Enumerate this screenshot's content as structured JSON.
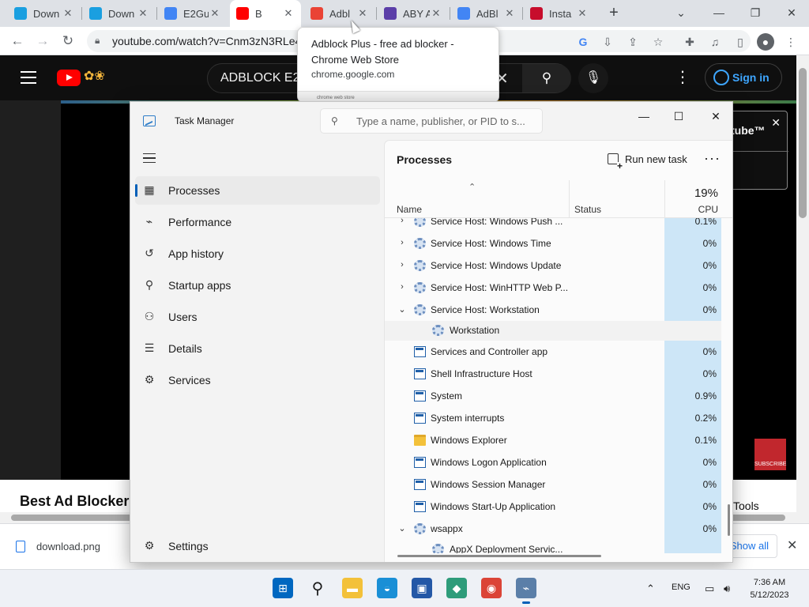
{
  "browser": {
    "tabs": [
      {
        "title": "Down",
        "icon": "diamond-favicon",
        "color": "#1a9fe0"
      },
      {
        "title": "Down",
        "icon": "diamond-favicon",
        "color": "#1a9fe0"
      },
      {
        "title": "E2Gu",
        "icon": "google-favicon",
        "color": "#4285f4"
      },
      {
        "title": "B",
        "icon": "youtube-favicon",
        "color": "#ff0000",
        "active": true
      },
      {
        "title": "Adbl",
        "icon": "chrome-webstore-favicon",
        "color": "#ea4335"
      },
      {
        "title": "ABY A",
        "icon": "aby-favicon",
        "color": "#5b3ea8"
      },
      {
        "title": "AdBl",
        "icon": "google-favicon",
        "color": "#4285f4"
      },
      {
        "title": "Insta",
        "icon": "abp-favicon",
        "color": "#c70d2c"
      }
    ],
    "url": "youtube.com/watch?v=Cnm3zN3RLe4",
    "tooltip": {
      "title": "Adblock Plus - free ad blocker - Chrome Web Store",
      "url": "chrome.google.com",
      "preview_text": "chrome web store"
    }
  },
  "youtube": {
    "search_query": "ADBLOCK E2",
    "sign_in": "Sign in",
    "banner_text": "tube™",
    "subscribe_badge": "SUBSCRIBE",
    "video_title": "Best Ad Blocker",
    "tools_label": "Tools"
  },
  "download_bar": {
    "file": "download.png",
    "show_all": "Show all"
  },
  "task_manager": {
    "title": "Task Manager",
    "search_placeholder": "Type a name, publisher, or PID to s...",
    "nav": [
      {
        "label": "Processes",
        "icon": "processes-icon",
        "glyph": "▦",
        "selected": true
      },
      {
        "label": "Performance",
        "icon": "performance-icon",
        "glyph": "⌁"
      },
      {
        "label": "App history",
        "icon": "app-history-icon",
        "glyph": "↺"
      },
      {
        "label": "Startup apps",
        "icon": "startup-apps-icon",
        "glyph": "⚲"
      },
      {
        "label": "Users",
        "icon": "users-icon",
        "glyph": "⚇"
      },
      {
        "label": "Details",
        "icon": "details-icon",
        "glyph": "☰"
      },
      {
        "label": "Services",
        "icon": "services-icon",
        "glyph": "⚙"
      }
    ],
    "settings_label": "Settings",
    "page_title": "Processes",
    "run_new_task": "Run new task",
    "columns": {
      "name": "Name",
      "status": "Status",
      "cpu_total": "19%",
      "cpu": "CPU"
    },
    "processes": [
      {
        "name": "Service Host: Windows Push ...",
        "cpu": "0.1%",
        "icon": "gear",
        "chevron": "›",
        "partial": true
      },
      {
        "name": "Service Host: Windows Time",
        "cpu": "0%",
        "icon": "gear",
        "chevron": "›"
      },
      {
        "name": "Service Host: Windows Update",
        "cpu": "0%",
        "icon": "gear",
        "chevron": "›"
      },
      {
        "name": "Service Host: WinHTTP Web P...",
        "cpu": "0%",
        "icon": "gear",
        "chevron": "›"
      },
      {
        "name": "Service Host: Workstation",
        "cpu": "0%",
        "icon": "gear",
        "chevron": "⌄"
      },
      {
        "name": "Workstation",
        "cpu": "",
        "icon": "gear",
        "child": true
      },
      {
        "name": "Services and Controller app",
        "cpu": "0%",
        "icon": "window"
      },
      {
        "name": "Shell Infrastructure Host",
        "cpu": "0%",
        "icon": "window"
      },
      {
        "name": "System",
        "cpu": "0.9%",
        "icon": "window"
      },
      {
        "name": "System interrupts",
        "cpu": "0.2%",
        "icon": "window"
      },
      {
        "name": "Windows Explorer",
        "cpu": "0.1%",
        "icon": "folder"
      },
      {
        "name": "Windows Logon Application",
        "cpu": "0%",
        "icon": "window"
      },
      {
        "name": "Windows Session Manager",
        "cpu": "0%",
        "icon": "window"
      },
      {
        "name": "Windows Start-Up Application",
        "cpu": "0%",
        "icon": "window"
      },
      {
        "name": "wsappx",
        "cpu": "0%",
        "icon": "gear",
        "chevron": "⌄"
      },
      {
        "name": "AppX Deployment Servic...",
        "cpu": "",
        "icon": "gear",
        "child": true
      }
    ]
  },
  "taskbar": {
    "apps": [
      {
        "name": "start-button",
        "color": "#0067c0",
        "glyph": "⊞"
      },
      {
        "name": "search-button",
        "color": "#eef1f6",
        "glyph": "⚲"
      },
      {
        "name": "file-explorer-app",
        "color": "#f3c13a",
        "glyph": "▬"
      },
      {
        "name": "edge-app",
        "color": "#1a8fd6",
        "glyph": "◒"
      },
      {
        "name": "store-app",
        "color": "#2458a6",
        "glyph": "▣"
      },
      {
        "name": "photos-app",
        "color": "#2e9c7a",
        "glyph": "◆"
      },
      {
        "name": "chrome-app",
        "color": "#db4437",
        "glyph": "◉"
      },
      {
        "name": "task-manager-app",
        "color": "#5b7fa8",
        "glyph": "⌁",
        "active": true
      }
    ],
    "language": "ENG",
    "time": "7:36 AM",
    "date": "5/12/2023"
  }
}
